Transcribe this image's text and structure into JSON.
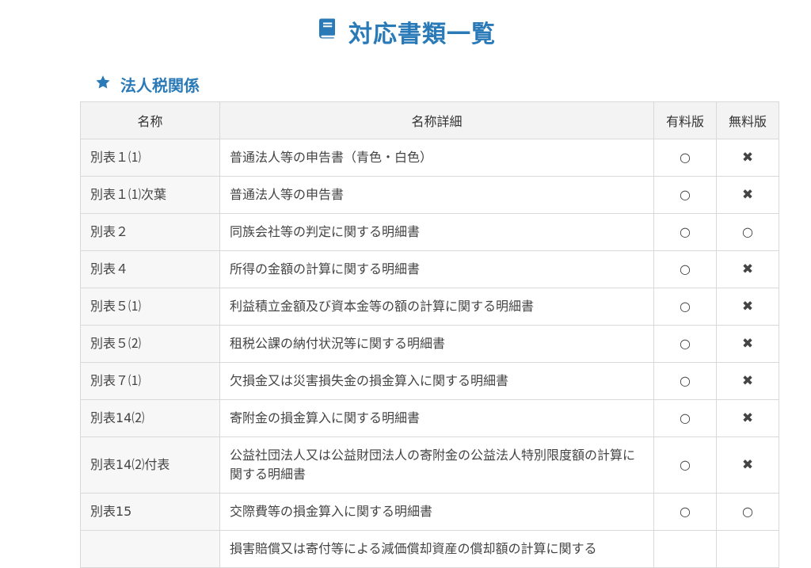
{
  "page_title": "対応書類一覧",
  "section": {
    "title": "法人税関係"
  },
  "table": {
    "headers": {
      "name": "名称",
      "detail": "名称詳細",
      "paid": "有料版",
      "free": "無料版"
    },
    "rows": [
      {
        "name": "別表１⑴",
        "detail": "普通法人等の申告書（青色・白色）",
        "paid": "○",
        "free": "✖"
      },
      {
        "name": "別表１⑴次葉",
        "detail": "普通法人等の申告書",
        "paid": "○",
        "free": "✖"
      },
      {
        "name": "別表２",
        "detail": "同族会社等の判定に関する明細書",
        "paid": "○",
        "free": "○"
      },
      {
        "name": "別表４",
        "detail": "所得の金額の計算に関する明細書",
        "paid": "○",
        "free": "✖"
      },
      {
        "name": "別表５⑴",
        "detail": "利益積立金額及び資本金等の額の計算に関する明細書",
        "paid": "○",
        "free": "✖"
      },
      {
        "name": "別表５⑵",
        "detail": "租税公課の納付状況等に関する明細書",
        "paid": "○",
        "free": "✖"
      },
      {
        "name": "別表７⑴",
        "detail": "欠損金又は災害損失金の損金算入に関する明細書",
        "paid": "○",
        "free": "✖"
      },
      {
        "name": "別表14⑵",
        "detail": "寄附金の損金算入に関する明細書",
        "paid": "○",
        "free": "✖"
      },
      {
        "name": "別表14⑵付表",
        "detail": "公益社団法人又は公益財団法人の寄附金の公益法人特別限度額の計算に関する明細書",
        "paid": "○",
        "free": "✖"
      },
      {
        "name": "別表15",
        "detail": "交際費等の損金算入に関する明細書",
        "paid": "○",
        "free": "○"
      },
      {
        "name": "",
        "detail": "損害賠償又は寄付等による減価償却資産の償却額の計算に関する",
        "paid": "",
        "free": ""
      }
    ]
  },
  "colors": {
    "accent": "#2a7ab8",
    "header_bg": "#f3f3f3",
    "name_cell_bg": "#f7f7f7",
    "column_divider": "#a9d8e8"
  },
  "icons": {
    "title": "book-icon",
    "section": "star-icon"
  }
}
